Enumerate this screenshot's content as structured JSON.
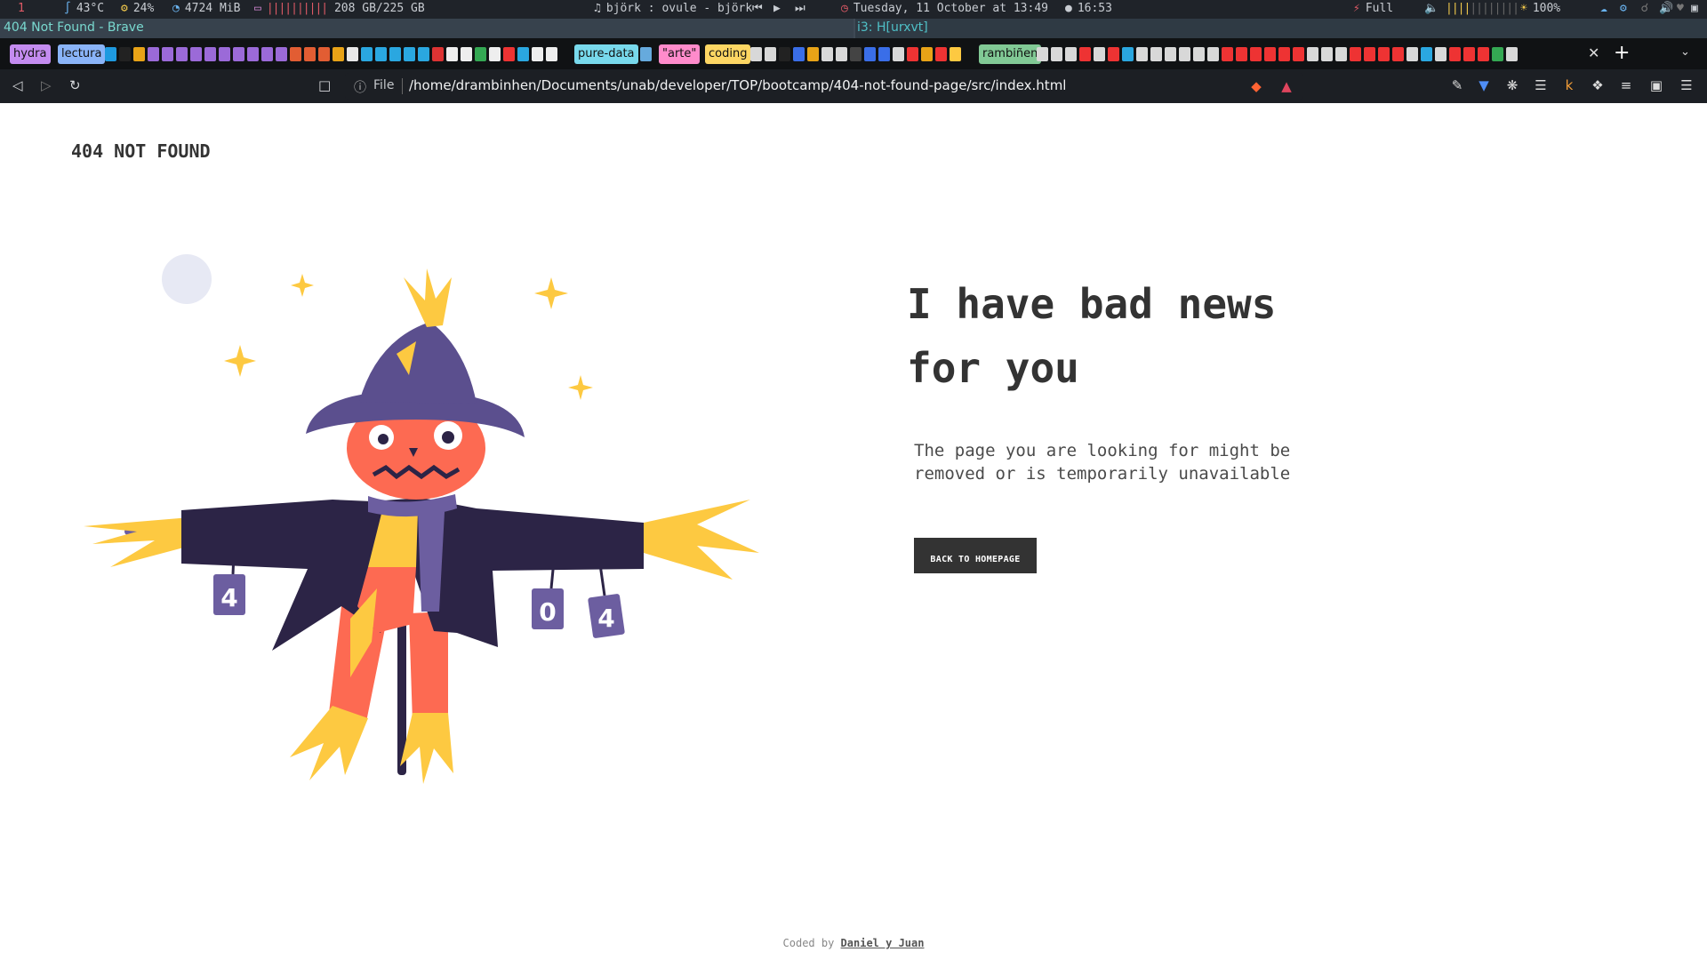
{
  "statusbar": {
    "workspace": "1",
    "temperature": "43°C",
    "cpu": "24%",
    "memory": "4724 MiB",
    "disk": "208 GB/225 GB",
    "music": "björk : ovule - björk",
    "datetime": "Tuesday, 11 October at 13:49",
    "timer": "16:53",
    "battery": "Full",
    "brightness": "100%"
  },
  "window": {
    "active_title": "404 Not Found - Brave",
    "inactive_title": "i3: H[urxvt]"
  },
  "tab_groups": [
    {
      "label": "hydra",
      "color": "#c48cf0"
    },
    {
      "label": "lectura",
      "color": "#8ab4f8"
    },
    {
      "label": "pure-data",
      "color": "#78d9ec"
    },
    {
      "label": "\"arte\"",
      "color": "#ff8bcb"
    },
    {
      "label": "coding",
      "color": "#fdd663"
    },
    {
      "label": "rambiñen",
      "color": "#81c995"
    }
  ],
  "toolbar": {
    "url_scheme": "File",
    "url": "/home/drambinhen/Documents/unab/developer/TOP/bootcamp/404-not-found-page/src/index.html"
  },
  "page": {
    "brand": "404 NOT FOUND",
    "headline_line1": "I have bad news",
    "headline_line2": "for you",
    "subtext_line1": "The page you are looking for might be",
    "subtext_line2": "removed or is temporarily unavailable",
    "button_label": "BACK TO HOMEPAGE",
    "footer_prefix": "Coded by ",
    "footer_link": "Daniel y Juan",
    "can_digits": [
      "4",
      "0",
      "4"
    ]
  },
  "colors": {
    "text_dark": "#333333",
    "button_bg": "#333333",
    "pumpkin": "#fd6a52",
    "coat": "#2c2446",
    "hat": "#5b4f8e",
    "straw": "#fdc941",
    "scarf": "#6c5ea0"
  }
}
